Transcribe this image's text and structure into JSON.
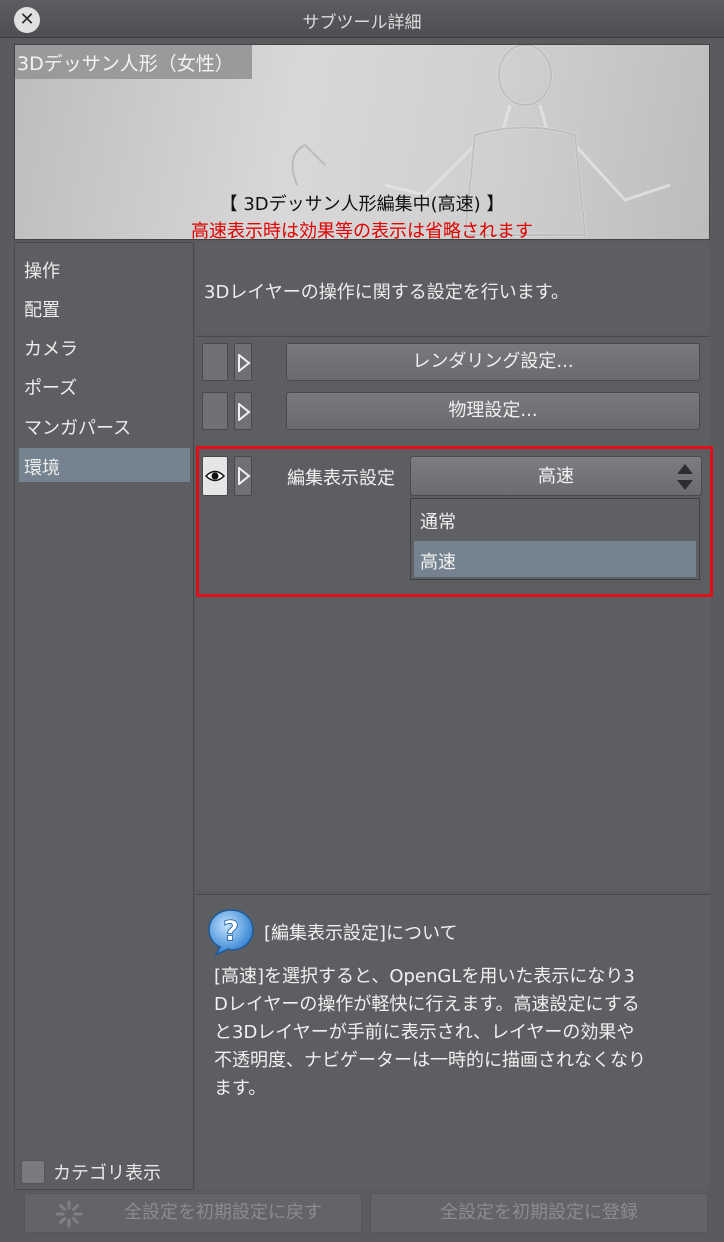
{
  "window": {
    "title": "サブツール詳細",
    "close_glyph": "✕"
  },
  "preview": {
    "name": "3Dデッサン人形（女性）",
    "status": "【 3Dデッサン人形編集中(高速) 】",
    "warning": "高速表示時は効果等の表示は省略されます"
  },
  "categories": {
    "items": [
      {
        "label": "操作"
      },
      {
        "label": "配置"
      },
      {
        "label": "カメラ"
      },
      {
        "label": "ポーズ"
      },
      {
        "label": "マンガパース"
      },
      {
        "label": "環境"
      }
    ],
    "selected_index": 5,
    "show_category_label": "カテゴリ表示"
  },
  "description": "3Dレイヤーの操作に関する設定を行います。",
  "settings": {
    "rendering_label": "レンダリング設定...",
    "physics_label": "物理設定...",
    "edit_display": {
      "label": "編集表示設定",
      "selected": "高速",
      "options": [
        "通常",
        "高速"
      ]
    }
  },
  "help": {
    "title": "[編集表示設定]について",
    "lines": [
      "[高速]を選択すると、OpenGLを用いた表示になり3",
      "Dレイヤーの操作が軽快に行えます。高速設定にする",
      "と3Dレイヤーが手前に表示され、レイヤーの効果や",
      "不透明度、ナビゲーターは一時的に描画されなくなり",
      "ます。"
    ]
  },
  "footer": {
    "reset_label": "全設定を初期設定に戻す",
    "register_label": "全設定を初期設定に登録"
  },
  "colors": {
    "highlight": "#e0101a",
    "selected": "#74838f",
    "warning": "#e00000"
  }
}
